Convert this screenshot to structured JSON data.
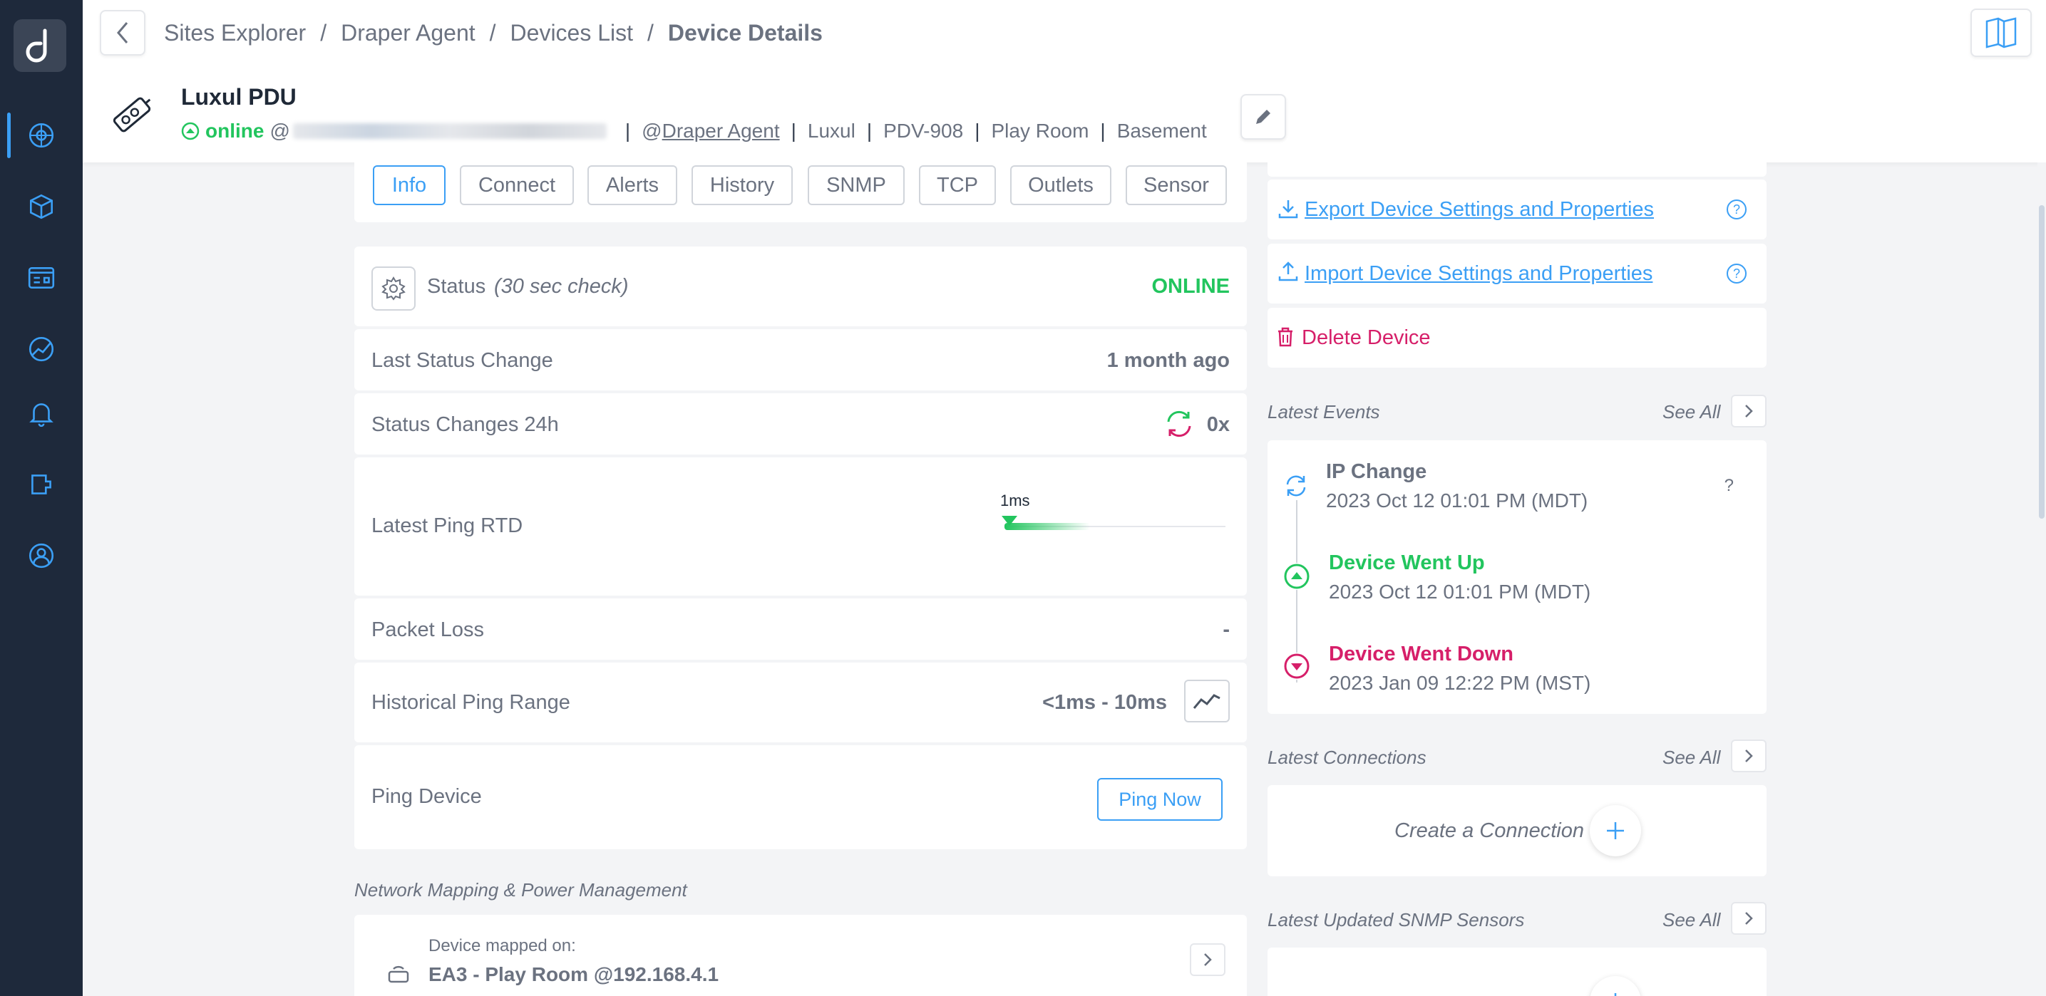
{
  "breadcrumb": {
    "items": [
      "Sites Explorer",
      "Draper Agent",
      "Devices List"
    ],
    "current": "Device Details"
  },
  "device": {
    "name": "Luxul PDU",
    "status": "online",
    "at_prefix": "@",
    "agent_prefix": "@",
    "agent": "Draper Agent",
    "vendor": "Luxul",
    "model": "PDV-908",
    "room": "Play Room",
    "location": "Basement"
  },
  "tabs": [
    "Info",
    "Connect",
    "Alerts",
    "History",
    "SNMP",
    "TCP",
    "Outlets",
    "Sensor"
  ],
  "active_tab": "Info",
  "status_row": {
    "label": "Status",
    "check": "(30 sec check)",
    "value": "ONLINE"
  },
  "rows": {
    "last_status_change": {
      "label": "Last Status Change",
      "value": "1 month ago"
    },
    "status_changes": {
      "label": "Status Changes 24h",
      "value": "0x"
    },
    "latest_ping": {
      "label": "Latest Ping RTD",
      "marker": "1ms"
    },
    "packet_loss": {
      "label": "Packet Loss",
      "value": "-"
    },
    "ping_range": {
      "label": "Historical Ping Range",
      "value": "<1ms - 10ms"
    },
    "ping_device": {
      "label": "Ping Device",
      "button": "Ping Now"
    }
  },
  "network": {
    "section_title": "Network Mapping & Power Management",
    "mapped_label": "Device mapped on:",
    "mapped_value": "EA3 - Play Room @192.168.4.1"
  },
  "actions": {
    "export": "Export Device Settings and Properties",
    "import": "Import Device Settings and Properties",
    "delete": "Delete Device"
  },
  "events": {
    "title": "Latest Events",
    "see_all": "See All",
    "items": [
      {
        "title": "IP Change",
        "time": "2023 Oct 12 01:01 PM (MDT)",
        "extra": "?"
      },
      {
        "title": "Device Went Up",
        "time": "2023 Oct 12 01:01 PM (MDT)"
      },
      {
        "title": "Device Went Down",
        "time": "2023 Jan 09 12:22 PM (MST)"
      }
    ]
  },
  "connections": {
    "title": "Latest Connections",
    "see_all": "See All",
    "create": "Create a Connection"
  },
  "snmp": {
    "title": "Latest Updated SNMP Sensors",
    "see_all": "See All"
  },
  "colors": {
    "accent": "#3b9ff5",
    "online": "#22c55e",
    "danger": "#d61f69",
    "sidebar": "#1e293b"
  }
}
